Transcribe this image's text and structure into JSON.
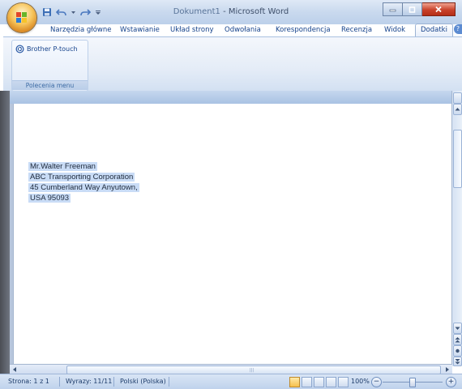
{
  "window": {
    "title_doc": "Dokument1",
    "title_sep": " - ",
    "title_app": "Microsoft Word"
  },
  "tabs": [
    {
      "label": "Narzędzia główne",
      "active": false
    },
    {
      "label": "Wstawianie",
      "active": false
    },
    {
      "label": "Układ strony",
      "active": false
    },
    {
      "label": "Odwołania",
      "active": false
    },
    {
      "label": "Korespondencja",
      "active": false
    },
    {
      "label": "Recenzja",
      "active": false
    },
    {
      "label": "Widok",
      "active": false
    },
    {
      "label": "Dodatki",
      "active": true
    }
  ],
  "ribbon": {
    "group_button_label": "Brother P-touch",
    "group_label": "Polecenia menu"
  },
  "document": {
    "address_lines": [
      "Mr.Walter Freeman",
      "ABC Transporting Corporation",
      "45 Cumberland Way Anyutown,",
      "USA 95093"
    ]
  },
  "statusbar": {
    "page": "Strona: 1 z 1",
    "words": "Wyrazy: 11/11",
    "language": "Polski (Polska)",
    "zoom": "100%",
    "zoom_level": 100
  },
  "colors": {
    "selection": "#c9dcf6",
    "accent": "#15428b"
  },
  "icons": {
    "office_button": "office-logo-icon",
    "save": "save-icon",
    "undo": "undo-icon",
    "redo": "redo-icon",
    "customize": "customize-qat-icon",
    "brother": "brother-ptouch-icon",
    "help": "help-icon"
  }
}
